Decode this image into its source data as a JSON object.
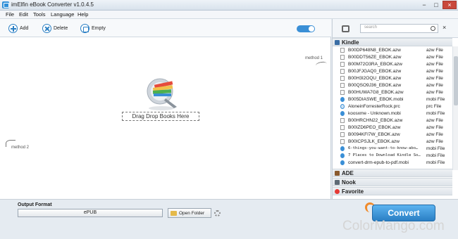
{
  "window": {
    "title": "imElfin eBook Converter v1.0.4.5",
    "controls": [
      "−",
      "□",
      "×"
    ]
  },
  "menu": [
    "File",
    "Edit",
    "Tools",
    "Language",
    "Help"
  ],
  "toolbar": {
    "add_label": "Add",
    "delete_label": "Delete",
    "empty_label": "Empty"
  },
  "drop_area": {
    "drag_text": "Drag Drop Books Here",
    "method1": "method 1",
    "method2": "method 2"
  },
  "output": {
    "label": "Output Format",
    "format": "ePUB",
    "open_folder": "Open Folder",
    "convert": "Convert"
  },
  "watermark": "ColorMango.com",
  "panel": {
    "search_placeholder": "search",
    "clear": "×",
    "categories": {
      "kindle": "Kindle",
      "ade": "ADE",
      "nook": "Nook",
      "favorite": "Favorite"
    },
    "files": [
      {
        "name": "B00DP648N8_EBOK.azw",
        "type": "azw File",
        "kind": "azw"
      },
      {
        "name": "B00DDT56ZE_EBOK.azw",
        "type": "azw File",
        "kind": "azw"
      },
      {
        "name": "B00M72O3RA_EBOK.azw",
        "type": "azw File",
        "kind": "azw"
      },
      {
        "name": "B00JFJGAQ0_EBOK.azw",
        "type": "azw File",
        "kind": "azw"
      },
      {
        "name": "B00H3I2OQU_EBOK.azw",
        "type": "azw File",
        "kind": "azw"
      },
      {
        "name": "B00QSO9J36_EBOK.azw",
        "type": "azw File",
        "kind": "azw"
      },
      {
        "name": "B00HUWA7G8_EBOK.azw",
        "type": "azw File",
        "kind": "azw"
      },
      {
        "name": "B005DIASWE_EBOK.mobi",
        "type": "mobi File",
        "kind": "mobi"
      },
      {
        "name": "AloneinForresterRock.prc",
        "type": "prc File",
        "kind": "prc"
      },
      {
        "name": "koosxme - Unknown.mobi",
        "type": "mobi File",
        "kind": "mobi"
      },
      {
        "name": "B00HRCHN22_EBOK.azw",
        "type": "azw File",
        "kind": "azw"
      },
      {
        "name": "B00IZD6PEO_EBOK.azw",
        "type": "azw File",
        "kind": "azw"
      },
      {
        "name": "B0094KFI7W_EBOK.azw",
        "type": "azw File",
        "kind": "azw"
      },
      {
        "name": "B00ICPSJLK_EBOK.azw",
        "type": "azw File",
        "kind": "azw"
      },
      {
        "name": "6-things-you-want-to-know-abo…",
        "type": "mobi File",
        "kind": "mobi"
      },
      {
        "name": "7 Places to Download Kindle So…",
        "type": "mobi File",
        "kind": "mobi"
      },
      {
        "name": "convert-drm-epub-to-pdf.mobi",
        "type": "mobi File",
        "kind": "mobi"
      }
    ]
  }
}
